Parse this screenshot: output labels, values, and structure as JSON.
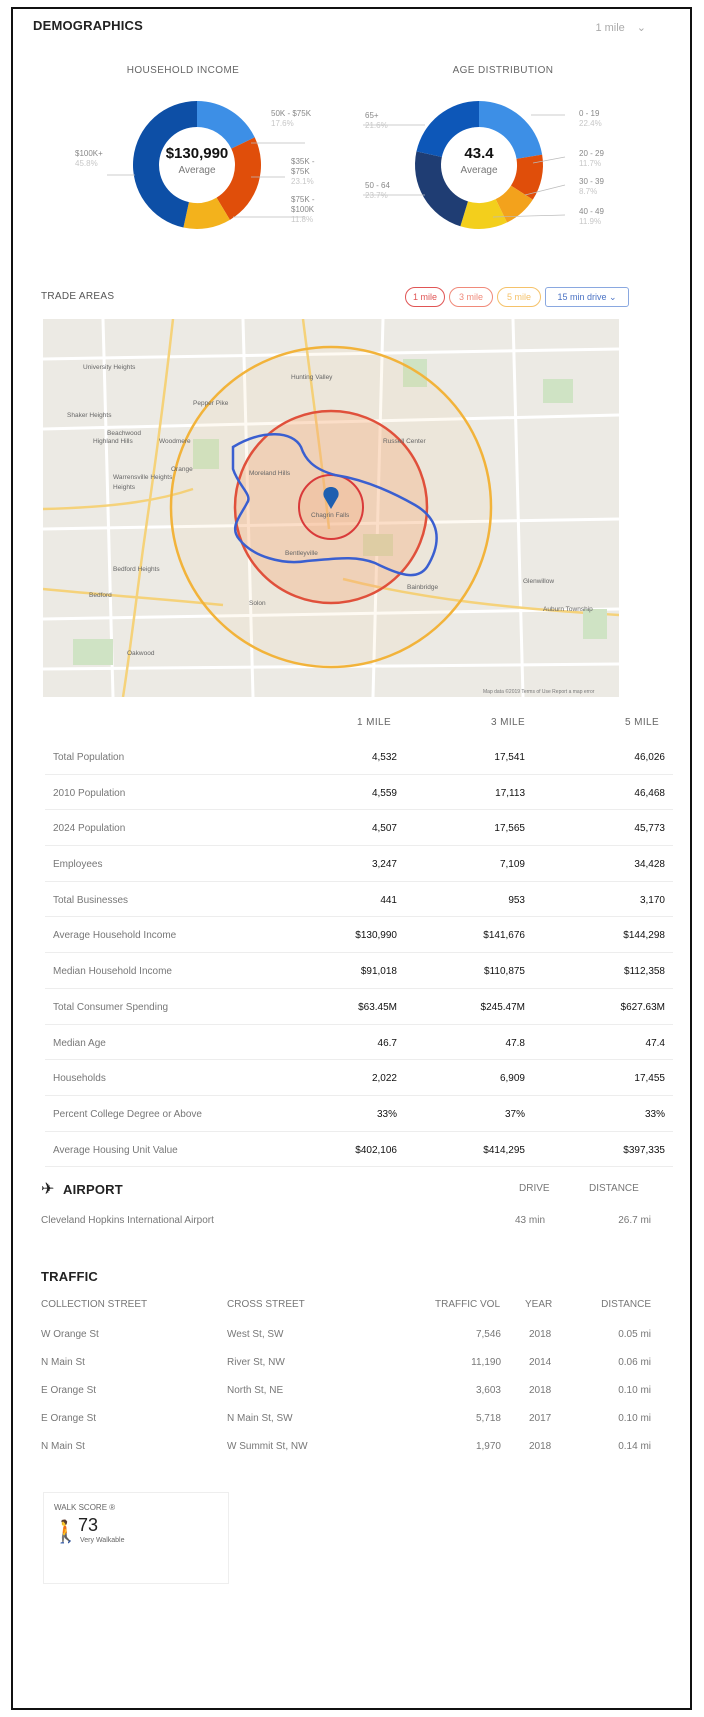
{
  "demographics": {
    "title": "DEMOGRAPHICS",
    "radius_select": "1 mile",
    "household_income": {
      "title": "HOUSEHOLD INCOME",
      "center_value": "$130,990",
      "center_label": "Average",
      "segments": [
        {
          "label": "50K - $75K",
          "percent": "17.6%",
          "value": 17.6,
          "color": "#3d8fe6"
        },
        {
          "label": "$75K - $100K",
          "percent": "23.1%",
          "value": 23.1,
          "color": "#e04e0a"
        },
        {
          "label": "$35K - $75K",
          "percent": "11.8%",
          "value": 11.8,
          "color": "#f3b21c"
        },
        {
          "label": "$100K+",
          "percent": "45.8%",
          "value": 45.8,
          "color": "#0d4fa6"
        }
      ],
      "labels": {
        "l1": "50K - $75K",
        "l1v": "17.6%",
        "l2a": "$35K -",
        "l2b": "$75K",
        "l2v": "23.1%",
        "l3a": "$75K -",
        "l3b": "$100K",
        "l3v": "11.8%",
        "l4": "$100K+",
        "l4v": "45.8%"
      }
    },
    "age_distribution": {
      "title": "AGE DISTRIBUTION",
      "center_value": "43.4",
      "center_label": "Average",
      "segments": [
        {
          "label": "0 - 19",
          "percent": "22.4%",
          "value": 22.4,
          "color": "#3d8fe6"
        },
        {
          "label": "20 - 29",
          "percent": "11.7%",
          "value": 11.7,
          "color": "#e04e0a"
        },
        {
          "label": "30 - 39",
          "percent": "8.7%",
          "value": 8.7,
          "color": "#f3a21c"
        },
        {
          "label": "40 - 49",
          "percent": "11.9%",
          "value": 11.9,
          "color": "#f3cf1c"
        },
        {
          "label": "50 - 64",
          "percent": "23.7%",
          "value": 23.7,
          "color": "#1f3d73"
        },
        {
          "label": "65+",
          "percent": "21.6%",
          "value": 21.6,
          "color": "#0d57b8"
        }
      ],
      "labels": {
        "a1": "0 - 19",
        "a1v": "22.4%",
        "a2": "20 - 29",
        "a2v": "11.7%",
        "a3": "30 - 39",
        "a3v": "8.7%",
        "a4": "40 - 49",
        "a4v": "11.9%",
        "a5": "50 - 64",
        "a5v": "23.7%",
        "a6": "65+",
        "a6v": "21.6%"
      }
    }
  },
  "trade_areas": {
    "title": "TRADE AREAS",
    "pills": [
      "1 mile",
      "3 mile",
      "5 mile"
    ],
    "drive_select": "15 min drive",
    "map": {
      "labels": [
        "University Heights",
        "Shaker Heights",
        "Warrensville Heights",
        "Highland Hills",
        "Beachwood",
        "Pepper Pike",
        "Hunting Valley",
        "Woodmere",
        "Orange",
        "Moreland Hills",
        "Chagrin Falls",
        "Bentleyville",
        "Bainbridge",
        "Solon",
        "Glenwillow",
        "Bedford Heights",
        "Bedford",
        "Oakwood",
        "Auburn Township",
        "Russell Center",
        "Heights"
      ],
      "footer": "Map data ©2019   Terms of Use   Report a map error"
    }
  },
  "stats": {
    "headers": [
      "1 MILE",
      "3 MILE",
      "5 MILE"
    ],
    "rows": [
      {
        "label": "Total Population",
        "v1": "4,532",
        "v3": "17,541",
        "v5": "46,026"
      },
      {
        "label": "2010 Population",
        "v1": "4,559",
        "v3": "17,113",
        "v5": "46,468"
      },
      {
        "label": "2024 Population",
        "v1": "4,507",
        "v3": "17,565",
        "v5": "45,773"
      },
      {
        "label": "Employees",
        "v1": "3,247",
        "v3": "7,109",
        "v5": "34,428"
      },
      {
        "label": "Total Businesses",
        "v1": "441",
        "v3": "953",
        "v5": "3,170"
      },
      {
        "label": "Average Household Income",
        "v1": "$130,990",
        "v3": "$141,676",
        "v5": "$144,298"
      },
      {
        "label": "Median Household Income",
        "v1": "$91,018",
        "v3": "$110,875",
        "v5": "$112,358"
      },
      {
        "label": "Total Consumer Spending",
        "v1": "$63.45M",
        "v3": "$245.47M",
        "v5": "$627.63M"
      },
      {
        "label": "Median Age",
        "v1": "46.7",
        "v3": "47.8",
        "v5": "47.4"
      },
      {
        "label": "Households",
        "v1": "2,022",
        "v3": "6,909",
        "v5": "17,455"
      },
      {
        "label": "Percent College Degree or Above",
        "v1": "33%",
        "v3": "37%",
        "v5": "33%"
      },
      {
        "label": "Average Housing Unit Value",
        "v1": "$402,106",
        "v3": "$414,295",
        "v5": "$397,335"
      }
    ]
  },
  "airport": {
    "title": "AIRPORT",
    "col_drive": "DRIVE",
    "col_distance": "DISTANCE",
    "name": "Cleveland Hopkins International Airport",
    "drive": "43 min",
    "distance": "26.7 mi"
  },
  "traffic": {
    "title": "TRAFFIC",
    "headers": {
      "collection": "COLLECTION STREET",
      "cross": "CROSS STREET",
      "vol": "TRAFFIC VOL",
      "year": "YEAR",
      "distance": "DISTANCE"
    },
    "rows": [
      {
        "collection": "W Orange St",
        "cross": "West St, SW",
        "vol": "7,546",
        "year": "2018",
        "distance": "0.05 mi"
      },
      {
        "collection": "N Main St",
        "cross": "River St, NW",
        "vol": "11,190",
        "year": "2014",
        "distance": "0.06 mi"
      },
      {
        "collection": "E Orange St",
        "cross": "North St, NE",
        "vol": "3,603",
        "year": "2018",
        "distance": "0.10 mi"
      },
      {
        "collection": "E Orange St",
        "cross": "N Main St, SW",
        "vol": "5,718",
        "year": "2017",
        "distance": "0.10 mi"
      },
      {
        "collection": "N Main St",
        "cross": "W Summit St, NW",
        "vol": "1,970",
        "year": "2018",
        "distance": "0.14 mi"
      }
    ]
  },
  "walk_score": {
    "label": "WALK SCORE ®",
    "score": "73",
    "description": "Very Walkable"
  }
}
